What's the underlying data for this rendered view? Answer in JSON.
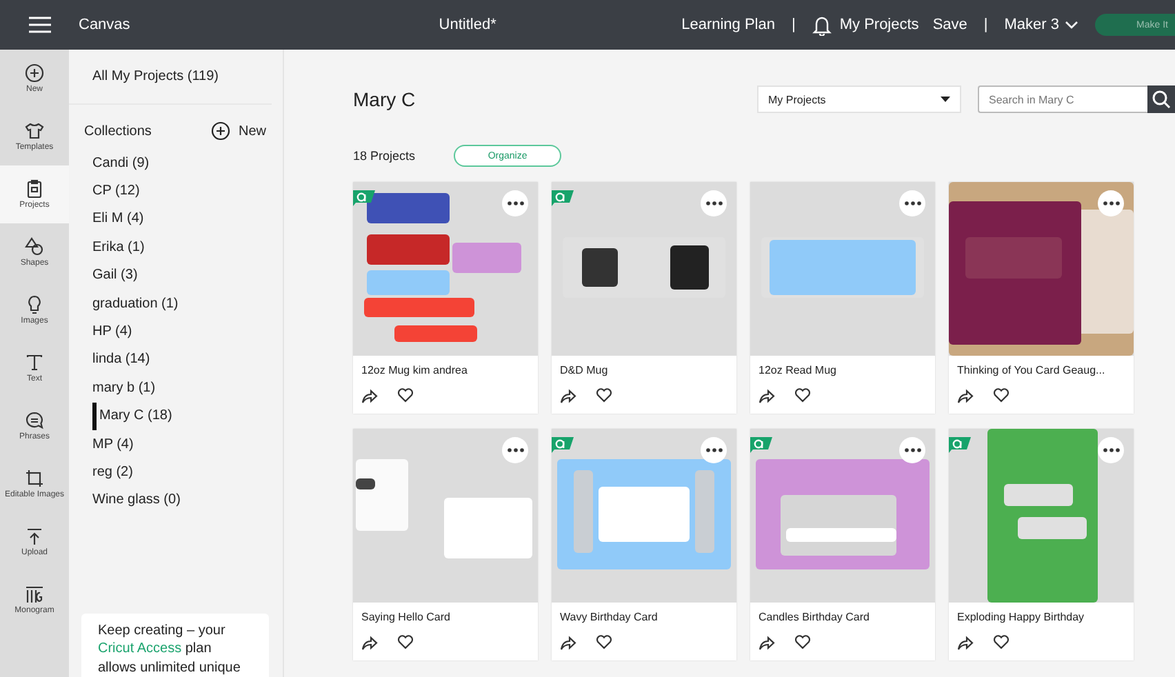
{
  "topbar": {
    "app": "Canvas",
    "document": "Untitled*",
    "learning": "Learning Plan",
    "separator_1": "|",
    "my_projects": "My Projects",
    "save": "Save",
    "separator_2": "|",
    "machine": "Maker 3",
    "make_it": "Make It"
  },
  "rail": [
    {
      "label": "New",
      "selected": false
    },
    {
      "label": "Templates",
      "selected": false
    },
    {
      "label": "Projects",
      "selected": true
    },
    {
      "label": "Shapes",
      "selected": false
    },
    {
      "label": "Images",
      "selected": false
    },
    {
      "label": "Text",
      "selected": false
    },
    {
      "label": "Phrases",
      "selected": false
    },
    {
      "label": "Editable Images",
      "selected": false
    },
    {
      "label": "Upload",
      "selected": false
    },
    {
      "label": "Monogram",
      "selected": false
    }
  ],
  "collections_panel": {
    "all": "All My Projects (119)",
    "heading": "Collections",
    "new": "New",
    "items": [
      {
        "label": "Candi (9)",
        "selected": false
      },
      {
        "label": "CP (12)",
        "selected": false
      },
      {
        "label": "Eli M (4)",
        "selected": false
      },
      {
        "label": "Erika (1)",
        "selected": false
      },
      {
        "label": "Gail (3)",
        "selected": false
      },
      {
        "label": "graduation (1)",
        "selected": false
      },
      {
        "label": "HP (4)",
        "selected": false
      },
      {
        "label": "linda (14)",
        "selected": false
      },
      {
        "label": "mary b (1)",
        "selected": false
      },
      {
        "label": "Mary C (18)",
        "selected": true
      },
      {
        "label": "MP (4)",
        "selected": false
      },
      {
        "label": "reg (2)",
        "selected": false
      },
      {
        "label": "Wine glass (0)",
        "selected": false
      }
    ],
    "promo": {
      "text_before": "Keep creating – your",
      "link": "Cricut Access",
      "text_after": "plan allows unlimited unique"
    }
  },
  "main": {
    "title": "Mary C",
    "filter": "My Projects",
    "search": {
      "placeholder": "Search in Mary C"
    },
    "count": "18 Projects",
    "organize": "Organize",
    "projects": [
      {
        "name": "12oz Mug kim andrea",
        "access": true
      },
      {
        "name": "D&D Mug",
        "access": true
      },
      {
        "name": "12oz Read Mug",
        "access": false
      },
      {
        "name": "Thinking of You Card Geaug...",
        "access": false
      },
      {
        "name": "Saying Hello Card",
        "access": false
      },
      {
        "name": "Wavy Birthday Card",
        "access": true
      },
      {
        "name": "Candles Birthday Card",
        "access": true
      },
      {
        "name": "Exploding Happy Birthday",
        "access": true
      }
    ]
  }
}
